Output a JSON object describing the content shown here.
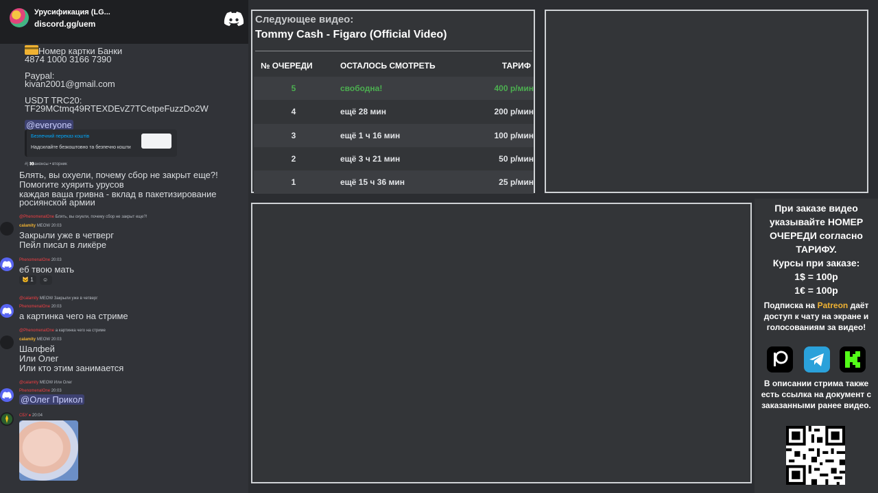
{
  "chat": {
    "server_name": "Урусификация (LG...",
    "server_invite": "discord.gg/uem",
    "card_line": "Номер картки Банки",
    "card_number": "4874 1000 3166 7390",
    "paypal_label": "Paypal:",
    "paypal_email": "kivan2001@gmail.com",
    "usdt_label": "USDT TRC20:",
    "usdt_address": "TF29MCtmq49RTEXDEvZ7TCetpeFuzzDo2W",
    "everyone_mention": "@everyone",
    "embed_title": "Безпечний переказ коштів",
    "embed_desc": "Надсилайте безкоштовно та безпечно кошти",
    "forward_meta": "#| 👀анонсы • вторник",
    "msg_complaint_1": "Блять, вы охуели, почему сбор не закрыт еще?!",
    "msg_complaint_2": "Помогите хуярить урусов",
    "msg_complaint_3": "каждая ваша гривна - вклад в пакетизирование",
    "msg_complaint_4": "росиянской армии",
    "reply1_author": "@PhenomenalOne",
    "reply1_text": "Блять, вы охуели, почему сбор не закрыт еще?!",
    "author_calamity": "calamity",
    "badge_meow": "MEOW",
    "time_2003": "20:03",
    "msg_thursday_1": "Закрыли уже в четверг",
    "msg_thursday_2": "Пейл писал в ликёре",
    "author_phenomenal": "PhenomenalOne",
    "msg_mother": "еб твою мать",
    "reaction_count": "1",
    "reply2_author": "@calamity",
    "reply2_text": "Закрыли уже в четверг",
    "msg_picture": "а картинка чего на стриме",
    "reply3_text": "а картинка чего на стриме",
    "msg_sage_1": "Шалфей",
    "msg_sage_2": "Или Олег",
    "msg_sage_3": "Или кто этим занимается",
    "reply4_text": "Или Олег",
    "mention_oleg": "@Олег Прикол",
    "author_sbu": "СБУ",
    "time_2004": "20:04"
  },
  "queue": {
    "next_label": "Следующее видео:",
    "next_title": "Tommy Cash - Figaro (Official Video)",
    "headers": [
      "№ ОЧЕРЕДИ",
      "ОСТАЛОСЬ СМОТРЕТЬ",
      "ТАРИФ"
    ],
    "rows": [
      {
        "num": "5",
        "left": "свободна!",
        "rate": "400 р/мин",
        "free": true
      },
      {
        "num": "4",
        "left": "ещё 28 мин",
        "rate": "200 р/мин",
        "free": false
      },
      {
        "num": "3",
        "left": "ещё 1 ч 16 мин",
        "rate": "100 р/мин",
        "free": false
      },
      {
        "num": "2",
        "left": "ещё 3 ч 21 мин",
        "rate": "50 р/мин",
        "free": false
      },
      {
        "num": "1",
        "left": "ещё 15 ч 36 мин",
        "rate": "25 р/мин",
        "free": false
      }
    ]
  },
  "info": {
    "order_note": "При заказе видео указывайте НОМЕР ОЧЕРЕДИ согласно ТАРИФУ.",
    "rates_title": "Курсы при заказе:",
    "rate_usd": "1$ = 100р",
    "rate_eur": "1€ = 100р",
    "patreon_prefix": "Подписка на",
    "patreon_word": "Patreon",
    "patreon_suffix": "даёт доступ к чату на экране и голосованиям за видео!",
    "desc_note": "В описании стрима также есть ссылка на документ с заказанными ранее видео."
  },
  "colors": {
    "accent_green": "#4caf50",
    "discord_blurple": "#5865f2",
    "patreon_yellow": "#f0b232"
  }
}
